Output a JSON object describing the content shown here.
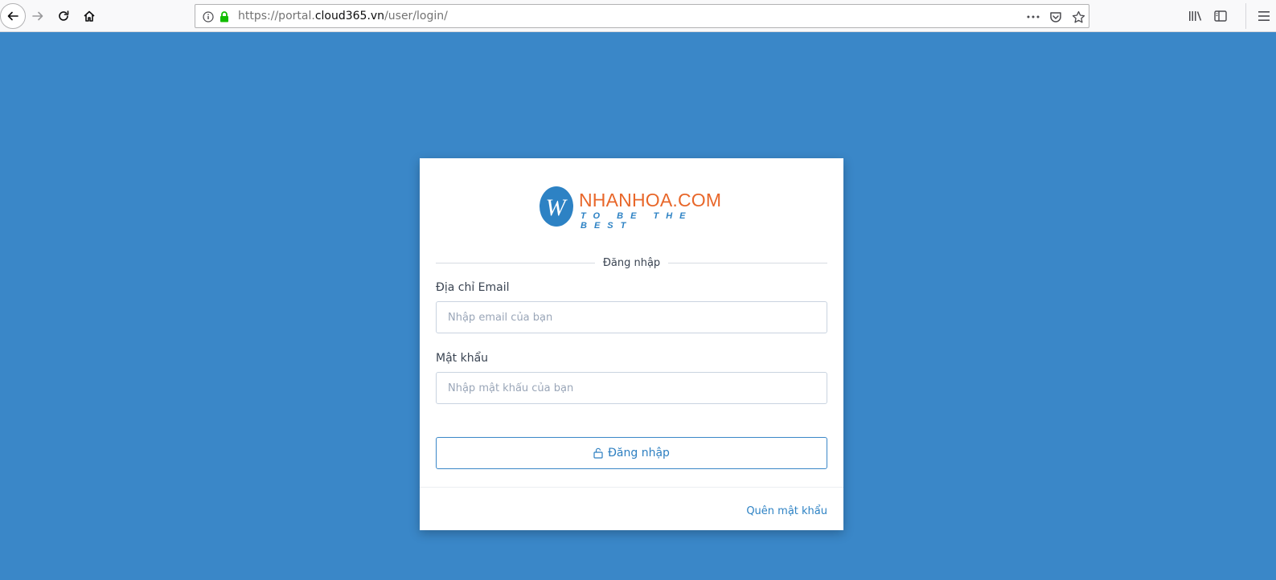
{
  "browser": {
    "url_prefix": "https://portal.",
    "url_host": "cloud365.vn",
    "url_path": "/user/login/"
  },
  "logo": {
    "mark": "W",
    "brand": "NHANHOA.COM",
    "tagline": "TO BE THE BEST"
  },
  "login": {
    "heading": "Đăng nhập",
    "email_label": "Địa chỉ Email",
    "email_placeholder": "Nhập email của bạn",
    "password_label": "Mật khẩu",
    "password_placeholder": "Nhập mật khẩu của bạn",
    "submit_label": "Đăng nhập",
    "forgot_label": "Quên mật khẩu"
  },
  "colors": {
    "page_background": "#3a87c8",
    "brand_orange": "#e8672a",
    "brand_blue": "#2d82c4"
  }
}
